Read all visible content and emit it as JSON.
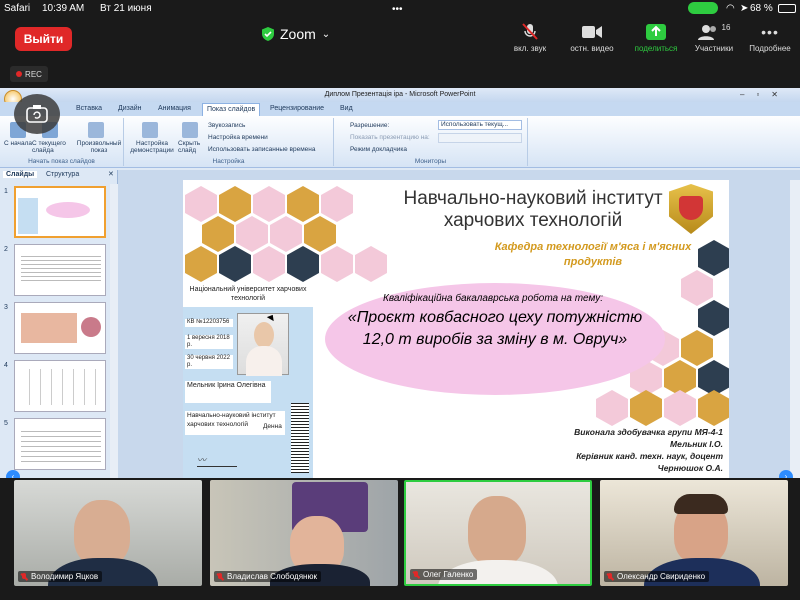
{
  "status_bar": {
    "carrier": "Safari",
    "time": "10:39 AM",
    "date": "Вт 21 июня",
    "battery": "68 %"
  },
  "zoom": {
    "leave_label": "Выйти",
    "title": "Zoom",
    "toolbar": [
      {
        "icon": "mic-muted-icon",
        "label": "вкл. звук"
      },
      {
        "icon": "video-camera-icon",
        "label": "остн. видео"
      },
      {
        "icon": "share-screen-icon",
        "label": "поделиться"
      },
      {
        "icon": "participants-icon",
        "label": "Участники",
        "count": "16"
      },
      {
        "icon": "more-icon",
        "label": "Подробнее"
      }
    ],
    "rec_label": "REC"
  },
  "ppt": {
    "window_title": "Диплом Презентація ipa - Microsoft PowerPoint",
    "tabs": [
      "Вставка",
      "Дизайн",
      "Анимация",
      "Показ слайдов",
      "Рецензирование",
      "Вид"
    ],
    "active_tab": "Показ слайдов",
    "ribbon": {
      "start_group_label": "Начать показ слайдов",
      "setup_group_label": "Настройка",
      "monitors_group_label": "Мониторы",
      "btn_from_start": "С начала",
      "btn_current": "С текущего слайда",
      "btn_custom": "Произвольный показ",
      "btn_setup": "Настройка демонстрации",
      "btn_hide": "Скрыть слайд",
      "opt_sound": "Звукозапись",
      "opt_timing": "Настройка времени",
      "opt_use_timing": "Использовать записанные времена",
      "res_label": "Разрешение:",
      "res_value": "Использовать текущ...",
      "show_on": "Показать презентацию на:",
      "presenter": "Режим докладчика"
    },
    "pane_tabs": [
      "Слайды",
      "Структура"
    ],
    "thumb_numbers": [
      "1",
      "2",
      "3",
      "4",
      "5"
    ]
  },
  "slide": {
    "title": "Навчально-науковий інститут харчових технологій",
    "department": "Кафедра технології м'яса і м'ясних продуктів",
    "subtitle": "Кваліфікаційна бакалаврська робота на тему:",
    "project": "«Проєкт ковбасного цеху потужністю 12,0 т виробів за зміну в м. Овруч»",
    "author_line1": "Виконала здобувачка групи МЯ-4-1",
    "author_line2": "Мельник І.О.",
    "author_line3": "Керівник канд. техн. наук, доцент",
    "author_line4": "Чернюшок О.А.",
    "card_title": "Національний університет харчових технологій",
    "card_series": "КВ №12203756",
    "card_issued_date": "1 вересня 2018 р.",
    "card_valid": "30 червня 2022 р.",
    "card_name": "Мельник Ірина Олегівна",
    "card_institute": "Навчально-науковий інститут харчових технологій",
    "card_form": "Денна"
  },
  "participants": [
    {
      "name": "Володимир Яцков"
    },
    {
      "name": "Владислав Слободянюк"
    },
    {
      "name": "Олег Галенко"
    },
    {
      "name": "Олександр Свириденко"
    }
  ],
  "colors": {
    "leave_red": "#e02828",
    "active_speaker": "#2ecc40",
    "hex_gold": "#d9a441",
    "hex_pink": "#f3c9d9",
    "hex_navy": "#2d3e50",
    "ellipse_pink": "#f5c6e8"
  }
}
